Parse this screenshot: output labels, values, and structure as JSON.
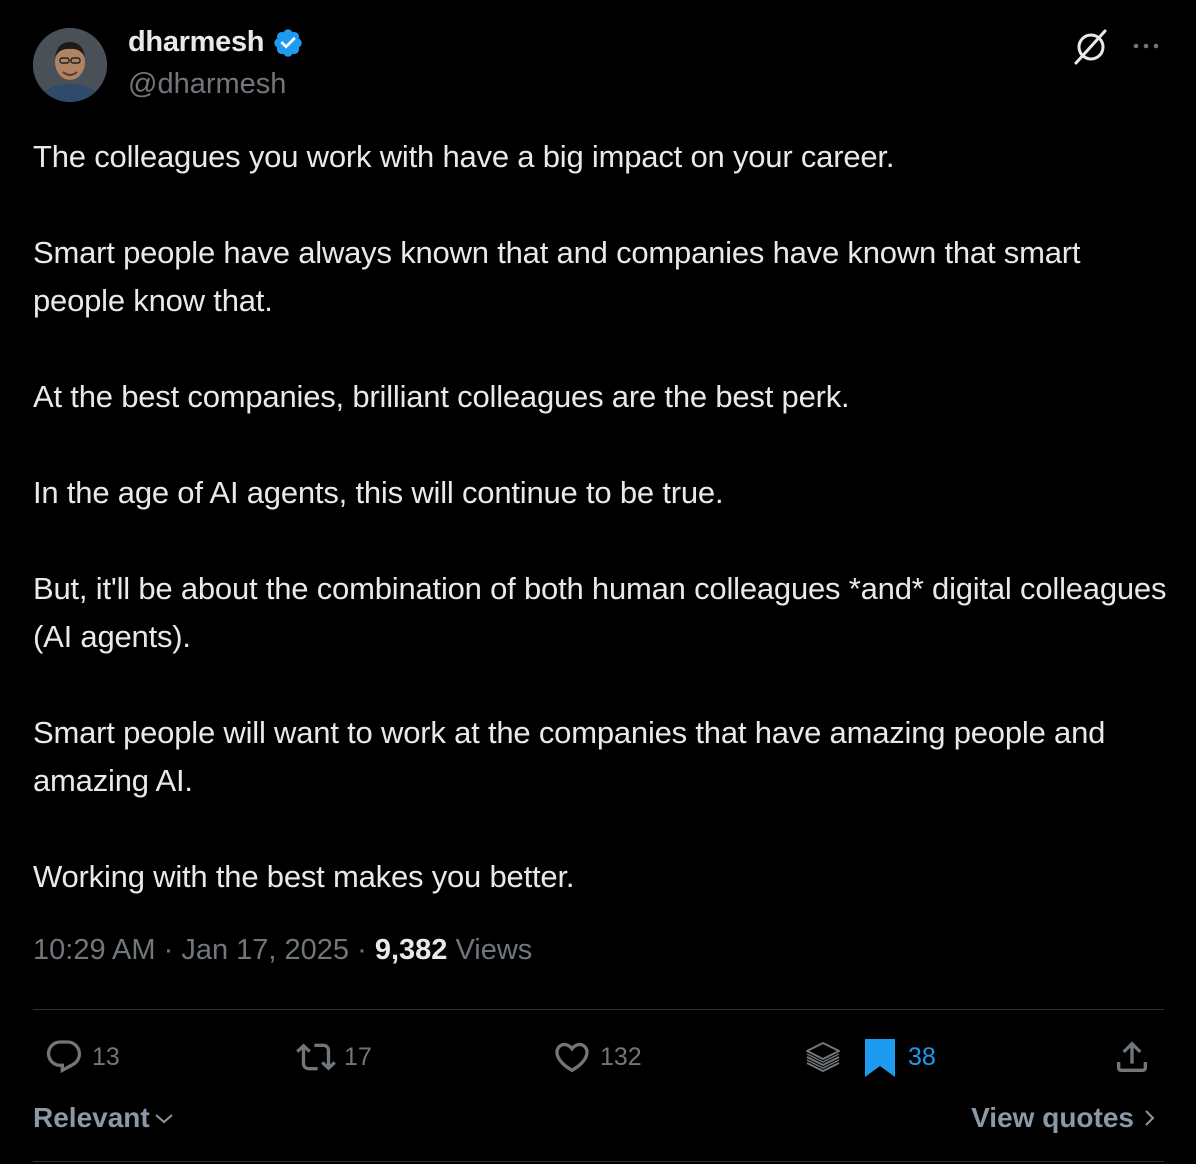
{
  "author": {
    "display_name": "dharmesh",
    "handle": "@dharmesh",
    "verified": true
  },
  "tweet": {
    "paragraphs": [
      "The colleagues you work with have a big impact on your career.",
      "Smart people have always known that and companies have known that smart people know that.",
      "At the best companies, brilliant colleagues are the best perk.",
      "In the age of AI agents, this will continue to be true.",
      "But, it'll be about the combination of both human colleagues *and* digital colleagues (AI agents).",
      "Smart people will want to work at the companies that have amazing people and amazing AI.",
      "Working with the best makes you better."
    ]
  },
  "meta": {
    "time": "10:29 AM",
    "separator": "·",
    "date": "Jan 17, 2025",
    "views_count": "9,382",
    "views_label": "Views"
  },
  "actions": {
    "replies": "13",
    "retweets": "17",
    "likes": "132",
    "bookmarks": "38"
  },
  "footer": {
    "sort_label": "Relevant",
    "view_quotes_label": "View quotes"
  },
  "colors": {
    "background": "#000000",
    "text": "#e7e9ea",
    "muted": "#71767b",
    "accent": "#1d9bf0"
  },
  "icons": [
    "verified-badge-icon",
    "grok-icon",
    "more-icon",
    "reply-icon",
    "retweet-icon",
    "like-icon",
    "grok-stack-icon",
    "bookmark-icon",
    "share-icon",
    "chevron-down-icon",
    "chevron-right-icon"
  ]
}
